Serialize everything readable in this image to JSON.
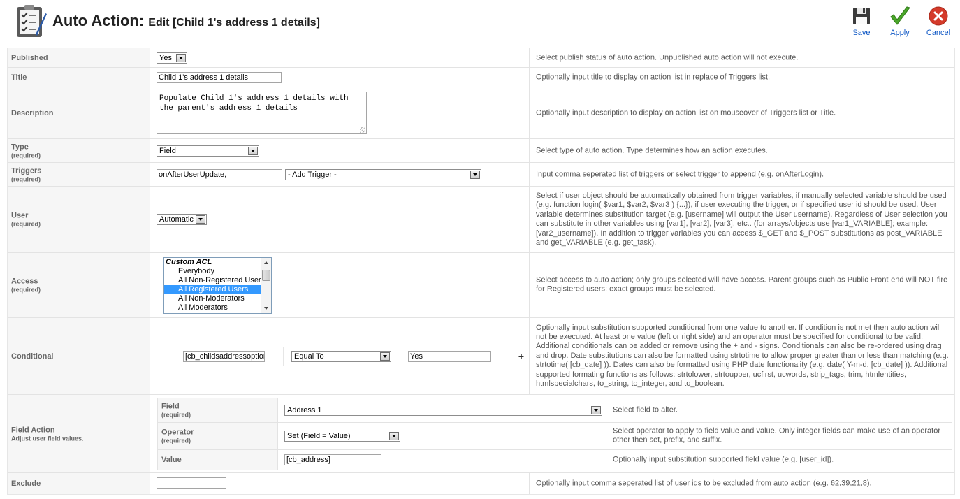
{
  "header": {
    "title": "Auto Action:",
    "subtitle": "Edit [Child 1's address 1 details]",
    "logo_icon": "clipboard-checklist-icon"
  },
  "toolbar": {
    "save": {
      "label": "Save",
      "icon": "floppy-disk-icon"
    },
    "apply": {
      "label": "Apply",
      "icon": "checkmark-icon",
      "color": "#4aa62a"
    },
    "cancel": {
      "label": "Cancel",
      "icon": "close-circle-icon",
      "color": "#d43a2a"
    }
  },
  "colors": {
    "link": "#0b55c4",
    "selection": "#3399ff"
  },
  "form": {
    "published": {
      "label": "Published",
      "value": "Yes",
      "help": "Select publish status of auto action. Unpublished auto action will not execute."
    },
    "title": {
      "label": "Title",
      "value": "Child 1's address 1 details",
      "help": "Optionally input title to display on action list in replace of Triggers list."
    },
    "description": {
      "label": "Description",
      "value_line1": "Populate Child 1's address 1 details with",
      "value_line2": "the parent's address 1 details",
      "help": "Optionally input description to display on action list on mouseover of Triggers list or Title."
    },
    "type": {
      "label": "Type",
      "required": "(required)",
      "value": "Field",
      "help": "Select type of auto action. Type determines how an action executes."
    },
    "triggers": {
      "label": "Triggers",
      "required": "(required)",
      "value": "onAfterUserUpdate,",
      "add_select": "- Add Trigger -",
      "help": "Input comma seperated list of triggers or select trigger to append (e.g. onAfterLogin)."
    },
    "user": {
      "label": "User",
      "required": "(required)",
      "value": "Automatic",
      "help": "Select if user object should be automatically obtained from trigger variables, if manually selected variable should be used (e.g. function login( $var1, $var2, $var3 ) {...}), if user executing the trigger, or if specified user id should be used. User variable determines substitution target (e.g. [username] will output the User username). Regardless of User selection you can substitute in other variables using [var1], [var2], [var3], etc.. (for arrays/objects use [var1_VARIABLE]; example: [var2_username]). In addition to trigger variables you can access $_GET and $_POST substitutions as post_VARIABLE and get_VARIABLE (e.g. get_task)."
    },
    "access": {
      "label": "Access",
      "required": "(required)",
      "options": [
        {
          "text": "Custom ACL",
          "group": true,
          "selected": false
        },
        {
          "text": "Everybody",
          "group": false,
          "selected": false
        },
        {
          "text": "All Non-Registered Users",
          "group": false,
          "selected": false
        },
        {
          "text": "All Registered Users",
          "group": false,
          "selected": true
        },
        {
          "text": "All Non-Moderators",
          "group": false,
          "selected": false
        },
        {
          "text": "All Moderators",
          "group": false,
          "selected": false
        }
      ],
      "help": "Select access to auto action; only groups selected will have access. Parent groups such as Public Front-end will NOT fire for Registered users; exact groups must be selected."
    },
    "conditional": {
      "label": "Conditional",
      "left_value": "[cb_childsaddressoption]",
      "operator": "Equal To",
      "right_value": "Yes",
      "add_symbol": "+",
      "help": "Optionally input substitution supported conditional from one value to another. If condition is not met then auto action will not be executed. At least one value (left or right side) and an operator must be specified for conditional to be valid. Additional conditionals can be added or remove using the + and - signs. Conditionals can also be re-ordered using drag and drop. Date substitutions can also be formatted using strtotime to allow proper greater than or less than matching (e.g. strtotime( [cb_date] )). Dates can also be formatted using PHP date functionality (e.g. date( Y-m-d, [cb_date] )). Additional supported formating functions as follows: strtolower, strtoupper, ucfirst, ucwords, strip_tags, trim, htmlentities, htmlspecialchars, to_string, to_integer, and to_boolean."
    },
    "field_action": {
      "label": "Field Action",
      "sublabel": "Adjust user field values.",
      "field": {
        "label": "Field",
        "required": "(required)",
        "value": "Address 1",
        "help": "Select field to alter."
      },
      "operator": {
        "label": "Operator",
        "required": "(required)",
        "value": "Set (Field = Value)",
        "help": "Select operator to apply to field value and value. Only integer fields can make use of an operator other then set, prefix, and suffix."
      },
      "value": {
        "label": "Value",
        "value": "[cb_address]",
        "help": "Optionally input substitution supported field value (e.g. [user_id])."
      }
    },
    "exclude": {
      "label": "Exclude",
      "value": "",
      "help": "Optionally input comma seperated list of user ids to be excluded from auto action (e.g. 62,39,21,8)."
    }
  }
}
